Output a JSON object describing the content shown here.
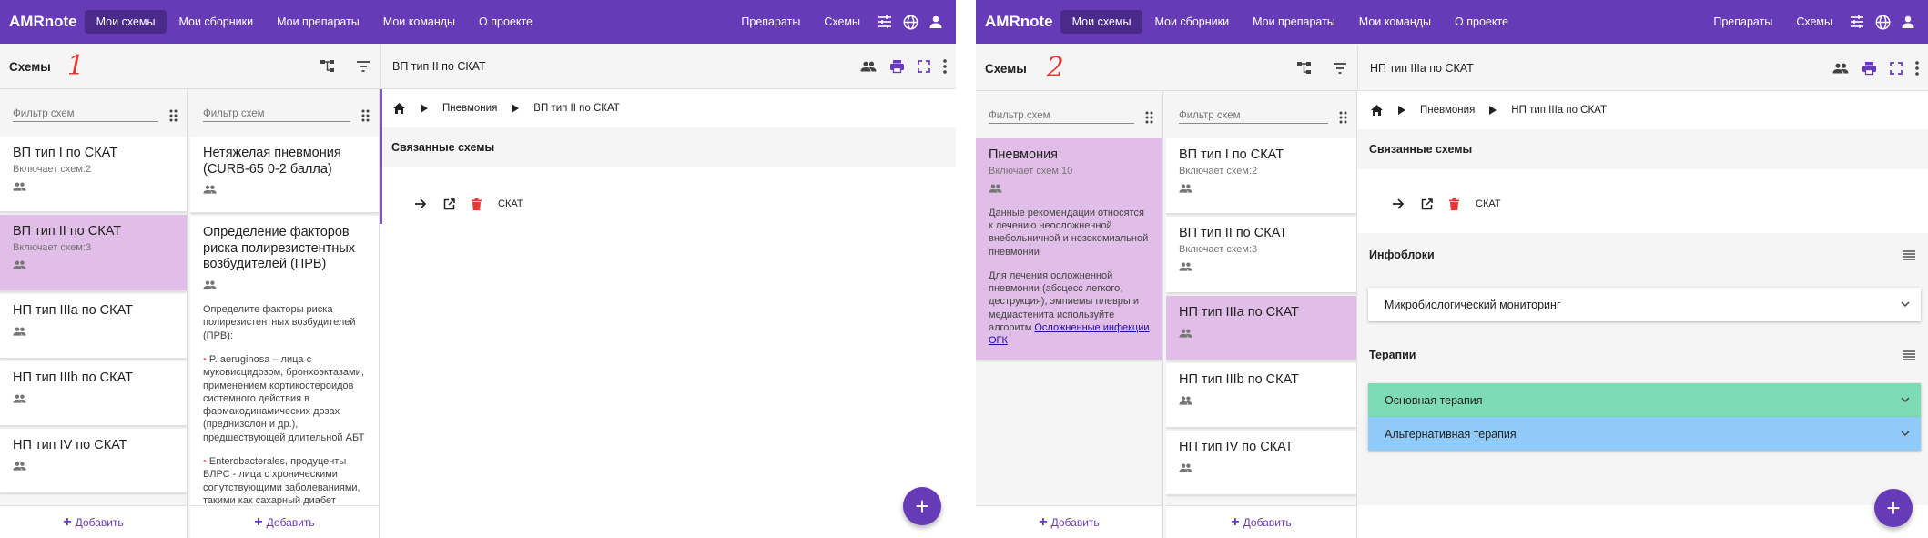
{
  "app": {
    "brand": "AMRnote",
    "nav": [
      "Мои схемы",
      "Мои сборники",
      "Мои препараты",
      "Мои команды",
      "О проекте"
    ],
    "right_links": [
      "Препараты",
      "Схемы"
    ],
    "icons": [
      "tune-icon",
      "globe-icon",
      "account-icon"
    ]
  },
  "colors": {
    "primary": "#673ab7",
    "selected": "#e1bee7",
    "delete": "#e53935",
    "main_therapy": "#7ddcb4",
    "alt_therapy": "#90caf9"
  },
  "common": {
    "schemes_title": "Схемы",
    "filter_placeholder": "Фильтр схем",
    "add_label": "Добавить",
    "related_title": "Связанные схемы",
    "related_item": "СКАТ",
    "crumb_pneumonia": "Пневмония",
    "includes_prefix": "Включает схем:"
  },
  "screen1": {
    "annotation": "1",
    "detail_title": "ВП тип II по СКАТ",
    "crumb_last": "ВП тип II по СКАТ",
    "col1": [
      {
        "title": "ВП тип I по СКАТ",
        "sub": "Включает схем:2"
      },
      {
        "title": "ВП тип II по СКАТ",
        "sub": "Включает схем:3"
      },
      {
        "title": "НП тип IIIa по СКАТ"
      },
      {
        "title": "НП тип IIIb по СКАТ"
      },
      {
        "title": "НП тип IV по СКАТ"
      }
    ],
    "col2": {
      "item1": "Нетяжелая пневмония (CURB-65 0-2 балла)",
      "item2": "Определение факторов риска полирезистентных возбудителей (ПРВ)",
      "desc_intro": "Определите факторы риска полирезистентных возбудителей (ПРВ):",
      "bullet1": "P. aeruginosa – лица с муковисцидозом, бронхоэктазами, применением кортикостероидов системного действия в фармакодинамических дозах (преднизолон и др.), предшествующей длительной АБТ",
      "bullet2": "Enterobacterales, продуценты БЛРС - лица с хроническими сопутствующими заболеваниями, такими как сахарный диабет"
    }
  },
  "screen2": {
    "annotation": "2",
    "detail_title": "НП тип IIIa по СКАТ",
    "crumb_last": "НП тип IIIa по СКАТ",
    "col1": {
      "title": "Пневмония",
      "sub": "Включает схем:10",
      "desc1": "Данные рекомендации относятся к лечению неосложненной внебольничной и нозокомиальной пневмонии",
      "desc2": "Для лечения осложненной пневмонии (абсцесс легкого, деструкция), эмпиемы плевры и медиастенита используйте алгоритм",
      "link": "Осложненные инфекции ОГК"
    },
    "col2": [
      {
        "title": "ВП тип I по СКАТ",
        "sub": "Включает схем:2"
      },
      {
        "title": "ВП тип II по СКАТ",
        "sub": "Включает схем:3"
      },
      {
        "title": "НП тип IIIa по СКАТ"
      },
      {
        "title": "НП тип IIIb по СКАТ"
      },
      {
        "title": "НП тип IV по СКАТ"
      }
    ],
    "infoblocks_title": "Инфоблоки",
    "infoblock_item": "Микробиологический мониторинг",
    "therapies_title": "Терапии",
    "therapy_main": "Основная терапия",
    "therapy_alt": "Альтернативная терапия"
  }
}
